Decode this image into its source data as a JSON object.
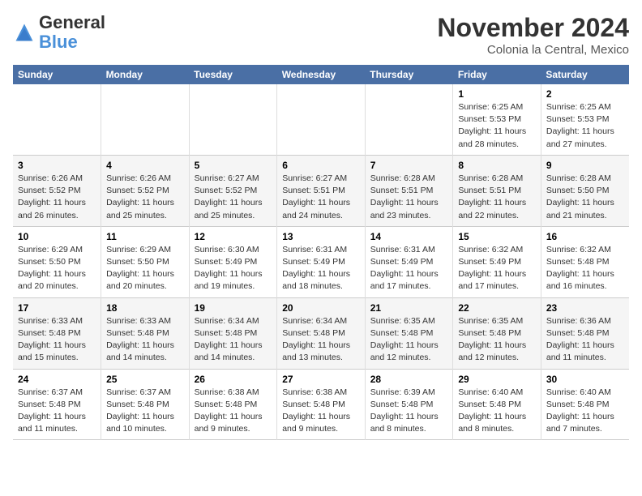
{
  "logo": {
    "general": "General",
    "blue": "Blue"
  },
  "title": "November 2024",
  "location": "Colonia la Central, Mexico",
  "days_header": [
    "Sunday",
    "Monday",
    "Tuesday",
    "Wednesday",
    "Thursday",
    "Friday",
    "Saturday"
  ],
  "weeks": [
    [
      {
        "num": "",
        "info": ""
      },
      {
        "num": "",
        "info": ""
      },
      {
        "num": "",
        "info": ""
      },
      {
        "num": "",
        "info": ""
      },
      {
        "num": "",
        "info": ""
      },
      {
        "num": "1",
        "info": "Sunrise: 6:25 AM\nSunset: 5:53 PM\nDaylight: 11 hours and 28 minutes."
      },
      {
        "num": "2",
        "info": "Sunrise: 6:25 AM\nSunset: 5:53 PM\nDaylight: 11 hours and 27 minutes."
      }
    ],
    [
      {
        "num": "3",
        "info": "Sunrise: 6:26 AM\nSunset: 5:52 PM\nDaylight: 11 hours and 26 minutes."
      },
      {
        "num": "4",
        "info": "Sunrise: 6:26 AM\nSunset: 5:52 PM\nDaylight: 11 hours and 25 minutes."
      },
      {
        "num": "5",
        "info": "Sunrise: 6:27 AM\nSunset: 5:52 PM\nDaylight: 11 hours and 25 minutes."
      },
      {
        "num": "6",
        "info": "Sunrise: 6:27 AM\nSunset: 5:51 PM\nDaylight: 11 hours and 24 minutes."
      },
      {
        "num": "7",
        "info": "Sunrise: 6:28 AM\nSunset: 5:51 PM\nDaylight: 11 hours and 23 minutes."
      },
      {
        "num": "8",
        "info": "Sunrise: 6:28 AM\nSunset: 5:51 PM\nDaylight: 11 hours and 22 minutes."
      },
      {
        "num": "9",
        "info": "Sunrise: 6:28 AM\nSunset: 5:50 PM\nDaylight: 11 hours and 21 minutes."
      }
    ],
    [
      {
        "num": "10",
        "info": "Sunrise: 6:29 AM\nSunset: 5:50 PM\nDaylight: 11 hours and 20 minutes."
      },
      {
        "num": "11",
        "info": "Sunrise: 6:29 AM\nSunset: 5:50 PM\nDaylight: 11 hours and 20 minutes."
      },
      {
        "num": "12",
        "info": "Sunrise: 6:30 AM\nSunset: 5:49 PM\nDaylight: 11 hours and 19 minutes."
      },
      {
        "num": "13",
        "info": "Sunrise: 6:31 AM\nSunset: 5:49 PM\nDaylight: 11 hours and 18 minutes."
      },
      {
        "num": "14",
        "info": "Sunrise: 6:31 AM\nSunset: 5:49 PM\nDaylight: 11 hours and 17 minutes."
      },
      {
        "num": "15",
        "info": "Sunrise: 6:32 AM\nSunset: 5:49 PM\nDaylight: 11 hours and 17 minutes."
      },
      {
        "num": "16",
        "info": "Sunrise: 6:32 AM\nSunset: 5:48 PM\nDaylight: 11 hours and 16 minutes."
      }
    ],
    [
      {
        "num": "17",
        "info": "Sunrise: 6:33 AM\nSunset: 5:48 PM\nDaylight: 11 hours and 15 minutes."
      },
      {
        "num": "18",
        "info": "Sunrise: 6:33 AM\nSunset: 5:48 PM\nDaylight: 11 hours and 14 minutes."
      },
      {
        "num": "19",
        "info": "Sunrise: 6:34 AM\nSunset: 5:48 PM\nDaylight: 11 hours and 14 minutes."
      },
      {
        "num": "20",
        "info": "Sunrise: 6:34 AM\nSunset: 5:48 PM\nDaylight: 11 hours and 13 minutes."
      },
      {
        "num": "21",
        "info": "Sunrise: 6:35 AM\nSunset: 5:48 PM\nDaylight: 11 hours and 12 minutes."
      },
      {
        "num": "22",
        "info": "Sunrise: 6:35 AM\nSunset: 5:48 PM\nDaylight: 11 hours and 12 minutes."
      },
      {
        "num": "23",
        "info": "Sunrise: 6:36 AM\nSunset: 5:48 PM\nDaylight: 11 hours and 11 minutes."
      }
    ],
    [
      {
        "num": "24",
        "info": "Sunrise: 6:37 AM\nSunset: 5:48 PM\nDaylight: 11 hours and 11 minutes."
      },
      {
        "num": "25",
        "info": "Sunrise: 6:37 AM\nSunset: 5:48 PM\nDaylight: 11 hours and 10 minutes."
      },
      {
        "num": "26",
        "info": "Sunrise: 6:38 AM\nSunset: 5:48 PM\nDaylight: 11 hours and 9 minutes."
      },
      {
        "num": "27",
        "info": "Sunrise: 6:38 AM\nSunset: 5:48 PM\nDaylight: 11 hours and 9 minutes."
      },
      {
        "num": "28",
        "info": "Sunrise: 6:39 AM\nSunset: 5:48 PM\nDaylight: 11 hours and 8 minutes."
      },
      {
        "num": "29",
        "info": "Sunrise: 6:40 AM\nSunset: 5:48 PM\nDaylight: 11 hours and 8 minutes."
      },
      {
        "num": "30",
        "info": "Sunrise: 6:40 AM\nSunset: 5:48 PM\nDaylight: 11 hours and 7 minutes."
      }
    ]
  ]
}
